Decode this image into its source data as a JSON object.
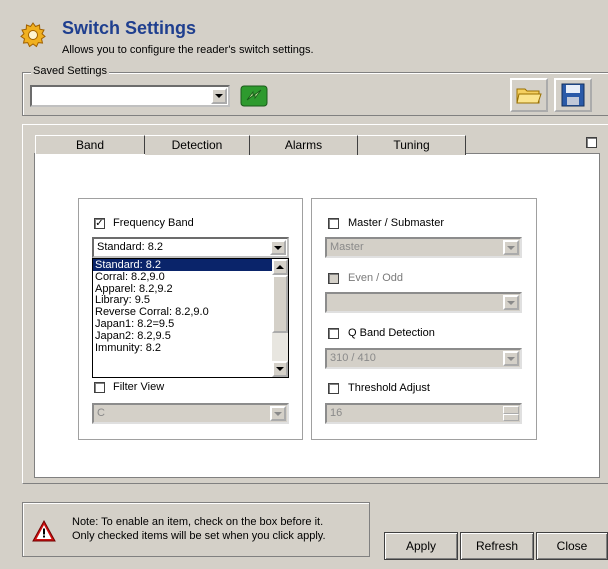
{
  "header": {
    "title": "Switch Settings",
    "subtitle": "Allows you to configure the reader's switch settings.",
    "icon": "gear-icon"
  },
  "saved_settings": {
    "legend": "Saved Settings",
    "value": "",
    "load_icon": "folder-open-icon",
    "save_icon": "save-disk-icon",
    "apply_icon": "green-arrow-icon"
  },
  "tabs": [
    {
      "label": "Band",
      "active": true
    },
    {
      "label": "Detection",
      "active": false
    },
    {
      "label": "Alarms",
      "active": false
    },
    {
      "label": "Tuning",
      "active": false
    }
  ],
  "band": {
    "frequency_band": {
      "label": "Frequency Band",
      "checked": true,
      "value": "Standard: 8.2"
    },
    "dropdown_options": [
      "Standard: 8.2",
      "Corral: 8.2,9.0",
      "Apparel: 8.2,9.2",
      "Library: 9.5",
      "Reverse Corral: 8.2,9.0",
      "Japan1: 8.2=9.5",
      "Japan2: 8.2,9.5",
      "Immunity: 8.2"
    ],
    "filter_view": {
      "label": "Filter View",
      "checked": false,
      "value": "C"
    },
    "master": {
      "label": "Master / Submaster",
      "checked": false,
      "value": "Master"
    },
    "even_odd": {
      "label": "Even / Odd",
      "checked": false,
      "value": ""
    },
    "q_band": {
      "label": "Q Band Detection",
      "checked": false,
      "value": "310 / 410"
    },
    "threshold": {
      "label": "Threshold Adjust",
      "checked": false,
      "value": "16"
    }
  },
  "note": {
    "line1": "Note: To enable an item, check on the box before it.",
    "line2": "Only checked items will be set when you click apply.",
    "icon": "warning-icon"
  },
  "buttons": {
    "apply": "Apply",
    "refresh": "Refresh",
    "close": "Close"
  },
  "colors": {
    "title": "#1f3f8f",
    "selection": "#0a246a",
    "window": "#d4d0c8"
  }
}
